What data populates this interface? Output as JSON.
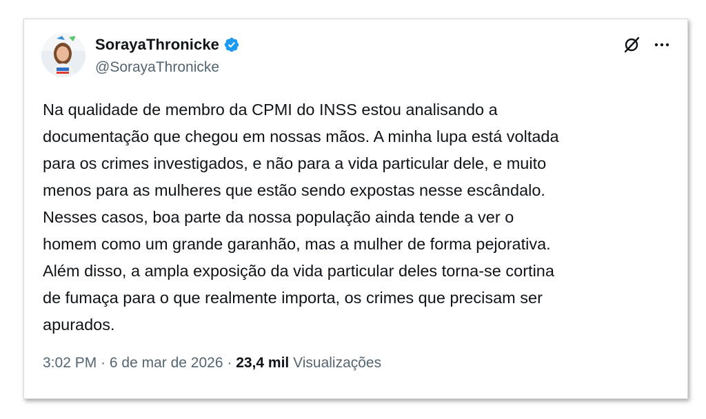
{
  "tweet": {
    "author": {
      "display_name": "SorayaThronicke",
      "handle": "@SorayaThronicke",
      "verified": true,
      "verified_color": "#1d9bf0",
      "avatar_icon": "profile-photo"
    },
    "text": "Na qualidade de membro da CPMI do INSS estou analisando a\ndocumentação que chegou em nossas mãos. A minha lupa está voltada\npara os crimes investigados, e não para a vida particular dele, e muito\nmenos para as mulheres que estão sendo expostas nesse escândalo.\nNesses casos, boa parte da nossa população ainda tende a ver o\nhomem como um grande garanhão, mas a mulher de forma pejorativa.\nAlém disso, a ampla exposição da vida particular deles torna-se cortina\nde fumaça para o que realmente importa, os crimes que precisam ser\napurados.",
    "time": "3:02 PM",
    "separator": " · ",
    "date": "6 de mar de 2026",
    "views_count": "23,4 mil",
    "views_label": "Visualizações",
    "actions": {
      "grok_icon": "grok-icon",
      "more_icon": "more-icon"
    }
  },
  "colors": {
    "text_primary": "#0f1419",
    "text_secondary": "#536471",
    "border": "#d6d9dc"
  }
}
